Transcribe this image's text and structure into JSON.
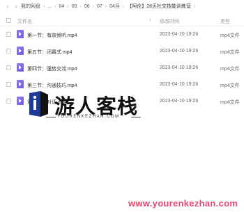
{
  "pathbar": {
    "back_icon": "chevron-left-icon",
    "forward_icon": "chevron-right-icon",
    "crumbs": [
      "我的网盘",
      "...",
      "04",
      "05",
      "06",
      "07",
      "04月",
      "【阿伦】28天社交技能训练营"
    ]
  },
  "header": {
    "name_label": "文件名",
    "time_label": "修改时间",
    "type_label": "类型"
  },
  "files": [
    {
      "name": "第一节：有效倾听.mp4",
      "time": "2023-04-10 19:26",
      "type": "mp4文件"
    },
    {
      "name": "第五节：闭幕式.mp4",
      "time": "2023-04-10 19:26",
      "type": "mp4文件"
    },
    {
      "name": "第四节：强势交流.mp4",
      "time": "2023-04-10 19:26",
      "type": "mp4文件"
    },
    {
      "name": "第三节：沟通技巧.mp4",
      "time": "2023-04-10 19:26",
      "type": "mp4文件"
    },
    {
      "name": "第二节：对话.mp4",
      "time": "2023-04-10 19:26",
      "type": "mp4文件"
    }
  ],
  "watermark": {
    "title": "游人客栈",
    "subtitle": "YOURENKEZHAN.COM",
    "url": "www.yourenkezhan.com",
    "url_color": "#e8476e"
  }
}
